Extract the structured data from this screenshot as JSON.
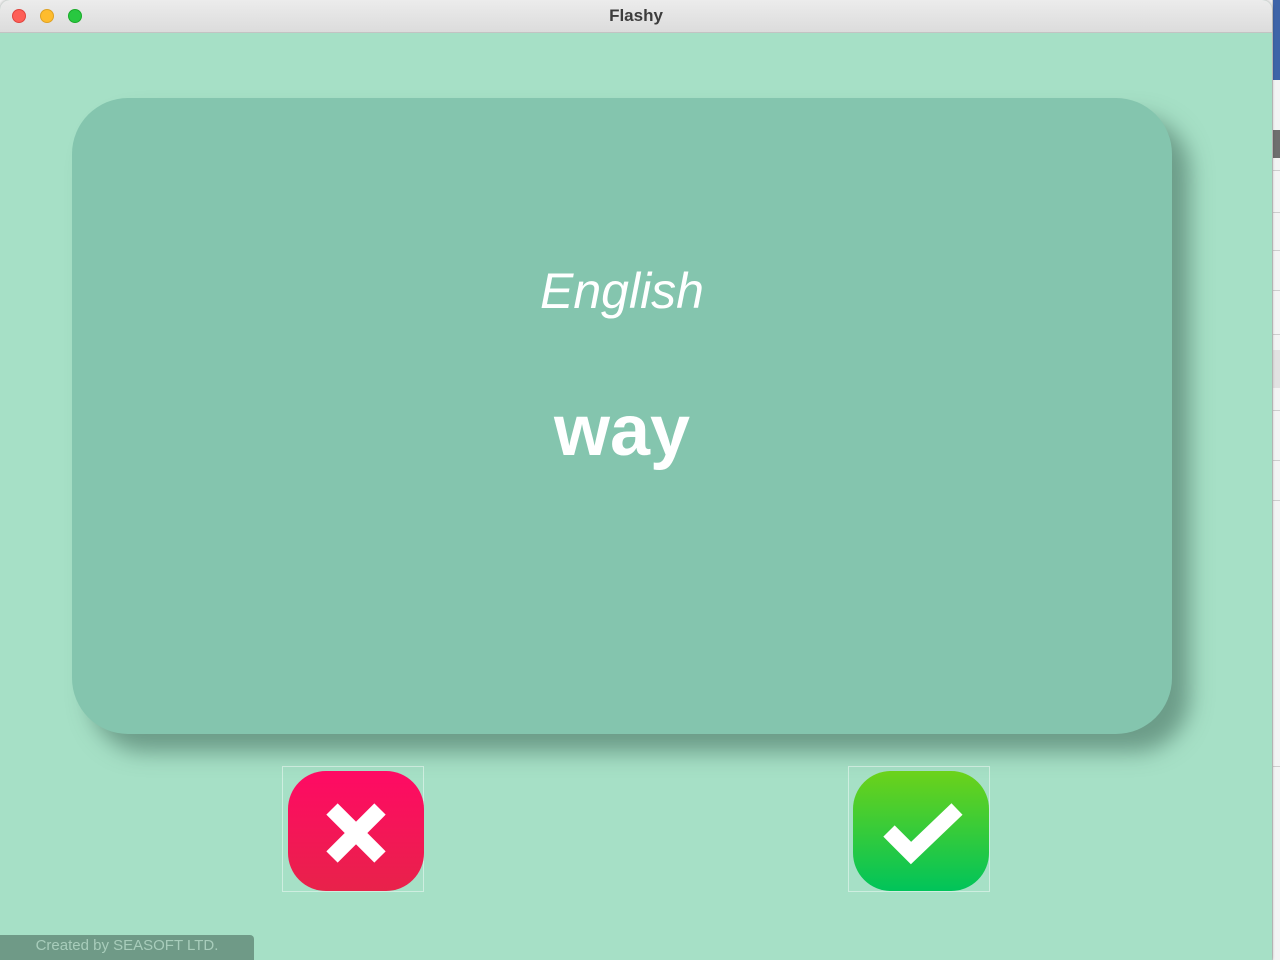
{
  "window": {
    "title": "Flashy"
  },
  "card": {
    "language": "English",
    "word": "way",
    "background_color": "#84c5ae"
  },
  "buttons": {
    "wrong": {
      "icon": "x-mark-icon",
      "color": "#ff0a64"
    },
    "right": {
      "icon": "checkmark-icon",
      "color": "#00c45a"
    }
  },
  "footer": {
    "credit": "Created by SEASOFT LTD."
  },
  "colors": {
    "window_background": "#a6e0c6"
  }
}
